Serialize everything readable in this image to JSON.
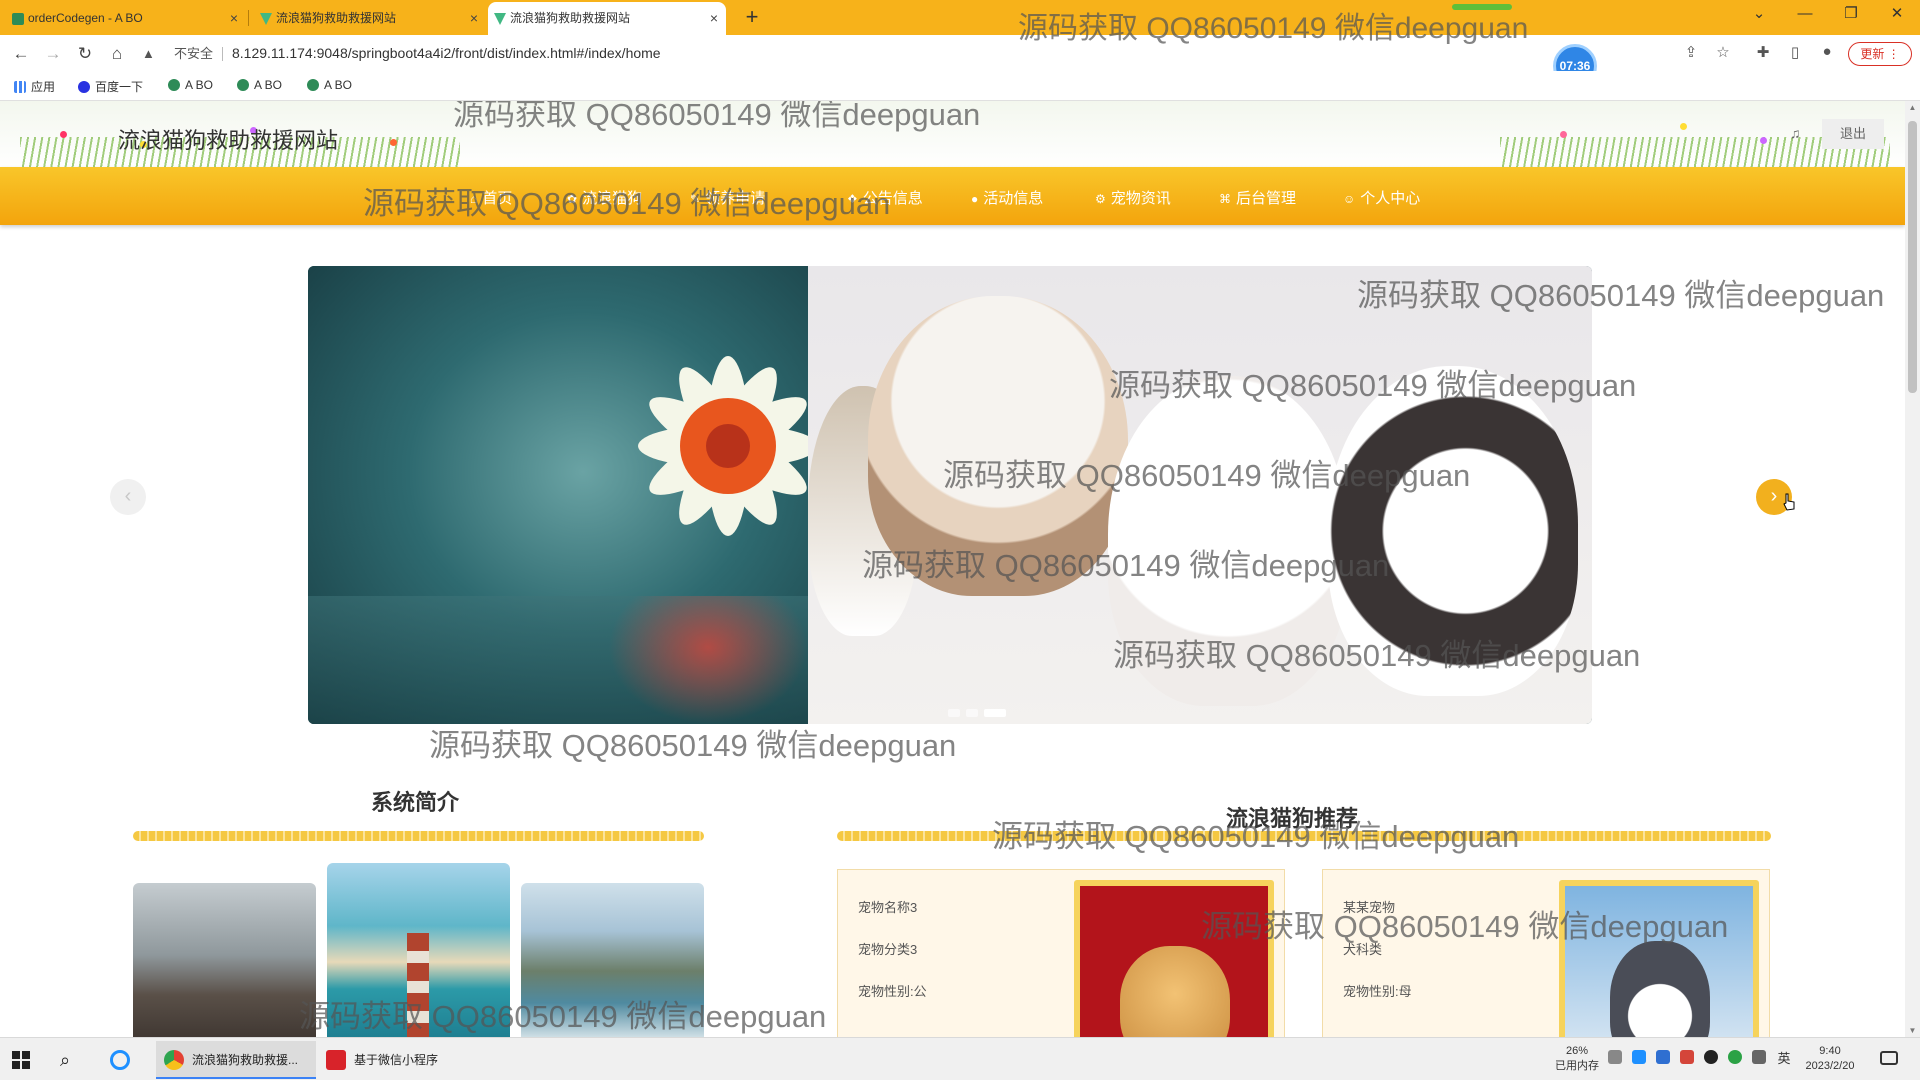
{
  "browser": {
    "tabs": [
      {
        "title": "orderCodegen - A BO",
        "active": false
      },
      {
        "title": "流浪猫狗救助救援网站",
        "active": false
      },
      {
        "title": "流浪猫狗救助救援网站",
        "active": true
      }
    ],
    "new_tab_label": "+",
    "window_controls": {
      "tab_search": "⌄",
      "minimize": "—",
      "restore": "❐",
      "close": "✕"
    },
    "security_label": "不安全",
    "url": "8.129.11.174:9048/springboot4a4i2/front/dist/index.html#/index/home",
    "timer": "07:36",
    "update_label": "更新",
    "bookmarks": [
      {
        "label": "应用",
        "color": "#4285f4"
      },
      {
        "label": "百度一下",
        "color": "#2932e1"
      },
      {
        "label": "A BO",
        "color": "#2e8b57"
      },
      {
        "label": "A BO",
        "color": "#2e8b57"
      },
      {
        "label": "A BO",
        "color": "#2e8b57"
      }
    ]
  },
  "site": {
    "title": "流浪猫狗救助救援网站",
    "logout_label": "退出",
    "nav": [
      {
        "icon": "home-icon",
        "glyph": "⌂",
        "label": "首页"
      },
      {
        "icon": "dog-icon",
        "glyph": "✿",
        "label": "流浪猫狗"
      },
      {
        "icon": "adopt-icon",
        "glyph": "✎",
        "label": "领养申请"
      },
      {
        "icon": "notice-icon",
        "glyph": "❖",
        "label": "公告信息"
      },
      {
        "icon": "activity-icon",
        "glyph": "●",
        "label": "活动信息"
      },
      {
        "icon": "news-icon",
        "glyph": "⚙",
        "label": "宠物资讯"
      },
      {
        "icon": "admin-icon",
        "glyph": "⌘",
        "label": "后台管理"
      },
      {
        "icon": "user-icon",
        "glyph": "☺",
        "label": "个人中心"
      }
    ],
    "carousel": {
      "prev_label": "‹",
      "next_label": "›",
      "slide_count": 3,
      "active_index": 2
    },
    "intro": {
      "title": "系统简介"
    },
    "pets": {
      "title": "流浪猫狗推荐",
      "cards": [
        {
          "name": "宠物名称3",
          "category": "宠物分类3",
          "gender": "宠物性别:公"
        },
        {
          "name": "某某宠物",
          "category": "犬科类",
          "gender": "宠物性别:母"
        }
      ]
    }
  },
  "watermark_text": "源码获取 QQ86050149 微信deepguan",
  "taskbar": {
    "apps": [
      {
        "label": "流浪猫狗救助救援...",
        "color": "#e34133",
        "active": true
      },
      {
        "label": "基于微信小程序的...",
        "color": "#d8232a",
        "active": false
      }
    ],
    "memory_percent": "26%",
    "memory_label": "已用内存",
    "ime_label": "英",
    "time": "9:40",
    "date": "2023/2/20"
  },
  "colors": {
    "accent": "#f7b21a",
    "nav_bg": "#f3a40c",
    "brand_blue": "#2f86e6"
  }
}
